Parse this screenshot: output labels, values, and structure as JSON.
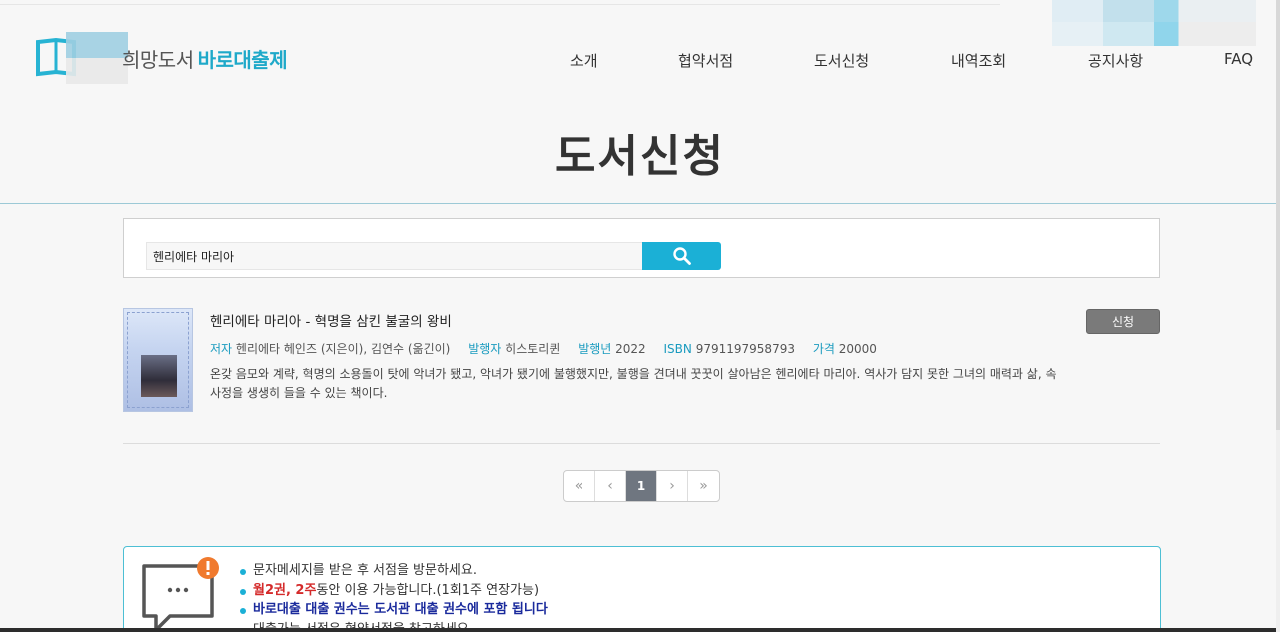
{
  "site": {
    "logo_text_a": "희망도서",
    "logo_text_b": "바로대출제"
  },
  "nav": [
    {
      "label": "소개"
    },
    {
      "label": "협약서점"
    },
    {
      "label": "도서신청"
    },
    {
      "label": "내역조회"
    },
    {
      "label": "공지사항"
    },
    {
      "label": "FAQ"
    }
  ],
  "page_title": "도서신청",
  "search": {
    "value": "헨리에타 마리아"
  },
  "result": {
    "title": "헨리에타 마리아 - 혁명을 삼킨 불굴의 왕비",
    "author_label": "저자",
    "author": "헨리에타 헤인즈 (지은이), 김연수 (옮긴이)",
    "publisher_label": "발행자",
    "publisher": "히스토리퀸",
    "year_label": "발행년",
    "year": "2022",
    "isbn_label": "ISBN",
    "isbn": "9791197958793",
    "price_label": "가격",
    "price": "20000",
    "description": "온갖 음모와 계략, 혁명의 소용돌이 탓에 악녀가 됐고, 악녀가 됐기에 불행했지만, 불행을 견뎌내 꿋꿋이 살아남은 헨리에타 마리아. 역사가 담지 못한 그녀의 매력과 삶, 속사정을 생생히 들을 수 있는 책이다.",
    "apply_label": "신청"
  },
  "pagination": {
    "first": "«",
    "prev": "‹",
    "current": "1",
    "next": "›",
    "last": "»"
  },
  "notice": {
    "line1": "문자메세지를 받은 후 서점을 방문하세요.",
    "line2_red1": "월2권, 2주",
    "line2_rest": "동안 이용 가능합니다.(1회1주 연장가능)",
    "line3": "바로대출 대출 권수는 도서관 대출 권수에 포함 됩니다",
    "line4_a": "대출가능 서점은 ",
    "line4_b": "협약서점",
    "line4_c": "을 참고하세요."
  },
  "colors": {
    "accent": "#1bb0d6",
    "label": "#1a9bbf",
    "notice_red": "#d42a2a",
    "notice_navy": "#1a2a9c"
  }
}
